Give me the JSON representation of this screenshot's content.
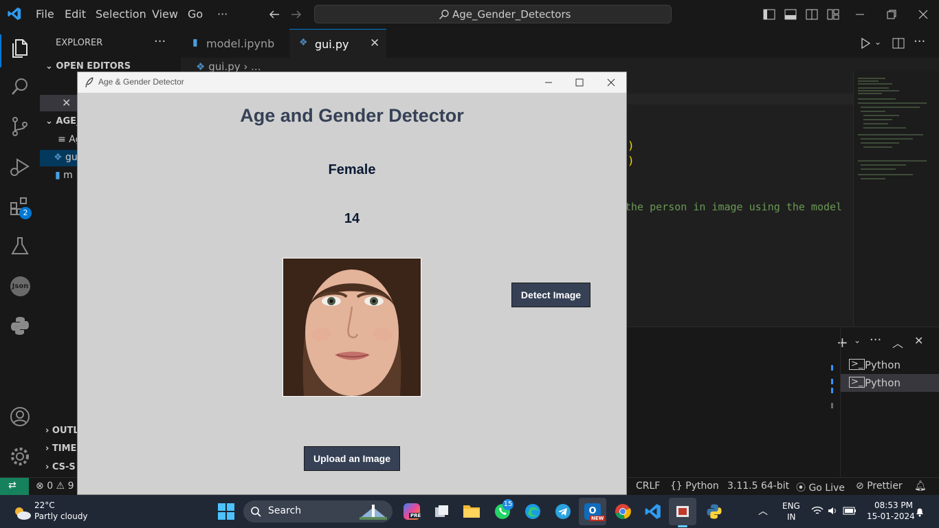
{
  "titlebar": {
    "menu": [
      "File",
      "Edit",
      "Selection",
      "View",
      "Go",
      "···"
    ],
    "search_text": "Age_Gender_Detectors"
  },
  "sidebar": {
    "header": "EXPLORER",
    "open_editors": "OPEN EDITORS",
    "folder": "AGE_",
    "files": [
      "Ag",
      "gu",
      "m"
    ],
    "outline": "OUTL",
    "timeline": "TIME",
    "cs": "CS-S"
  },
  "tabs": [
    {
      "label": "model.ipynb"
    },
    {
      "label": "gui.py"
    }
  ],
  "breadcrumb": {
    "file": "gui.py",
    "rest": "..."
  },
  "code": {
    "line1": ")",
    "line2": ")",
    "comment": "the person in image using the model"
  },
  "panel": {
    "terminals": [
      "Python",
      "Python"
    ]
  },
  "activity": {
    "extensions_badge": "2",
    "json_label": "Json"
  },
  "statusbar": {
    "errors": "0",
    "warnings": "9",
    "eol": "CRLF",
    "language": "Python",
    "interpreter": "3.11.5 64-bit",
    "golive": "Go Live",
    "prettier": "Prettier"
  },
  "taskbar": {
    "temp": "22°C",
    "weather": "Partly cloudy",
    "search": "Search",
    "whatsapp_badge": "15",
    "lang1": "ENG",
    "lang2": "IN",
    "time": "08:53 PM",
    "date": "15-01-2024",
    "copilot_badge": "PRE",
    "outlook_badge": "NEW"
  },
  "tkapp": {
    "window_title": "Age & Gender Detector",
    "heading": "Age and Gender Detector",
    "gender": "Female",
    "age": "14",
    "detect_button": "Detect Image",
    "upload_button": "Upload an Image"
  },
  "colors": {
    "accent_blue": "#0078d4",
    "statusbar_remote": "#16825d",
    "tk_bg": "#d0d0d0",
    "tk_button": "#364156",
    "tk_text": "#0b1a33"
  }
}
